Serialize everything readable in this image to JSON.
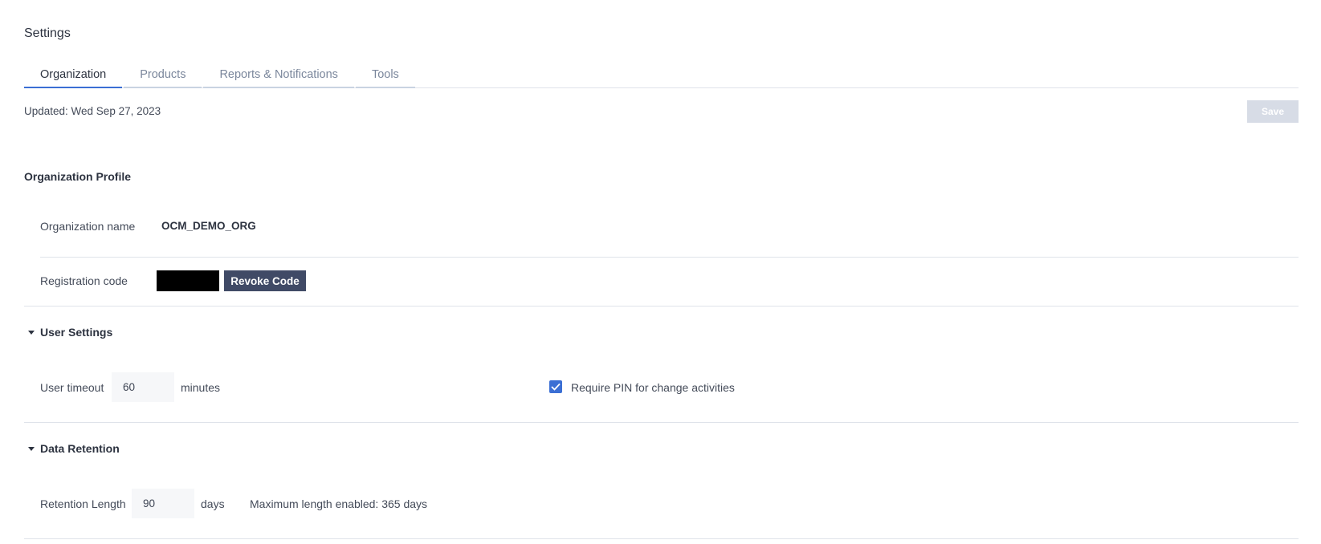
{
  "page": {
    "title": "Settings"
  },
  "tabs": [
    {
      "label": "Organization",
      "active": true
    },
    {
      "label": "Products",
      "active": false
    },
    {
      "label": "Reports & Notifications",
      "active": false
    },
    {
      "label": "Tools",
      "active": false
    }
  ],
  "header": {
    "updated": "Updated: Wed Sep 27, 2023",
    "save_label": "Save"
  },
  "org_profile": {
    "title": "Organization Profile",
    "name_label": "Organization name",
    "name_value": "OCM_DEMO_ORG",
    "reg_label": "Registration code",
    "revoke_label": "Revoke Code"
  },
  "user_settings": {
    "title": "User Settings",
    "timeout_label": "User timeout",
    "timeout_value": "60",
    "timeout_unit": "minutes",
    "pin_label": "Require PIN for change activities",
    "pin_checked": true
  },
  "data_retention": {
    "title": "Data Retention",
    "length_label": "Retention Length",
    "length_value": "90",
    "length_unit": "days",
    "max_note": "Maximum length enabled: 365 days"
  },
  "colors": {
    "accent": "#3b6fd4",
    "dark_button": "#404a66",
    "disabled_button": "#d7dce6"
  }
}
